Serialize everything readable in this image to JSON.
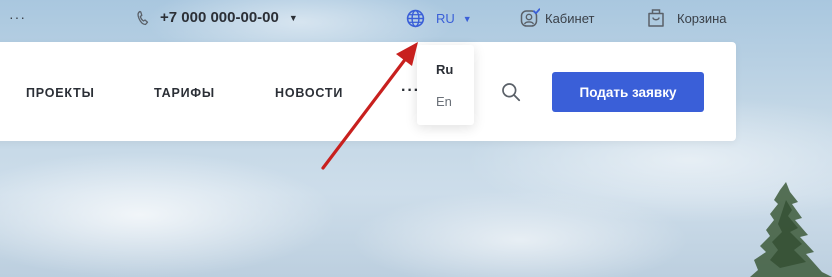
{
  "topbar": {
    "more_label": "···",
    "phone": "+7 000 000-00-00",
    "language": "RU",
    "cabinet_label": "Кабинет",
    "cart_label": "Корзина"
  },
  "nav": {
    "items": [
      "ПРОЕКТЫ",
      "ТАРИФЫ",
      "НОВОСТИ"
    ],
    "more_label": "···",
    "cta_label": "Подать заявку"
  },
  "language_dropdown": {
    "options": [
      "Ru",
      "En"
    ],
    "selected": "Ru"
  },
  "colors": {
    "accent": "#3a5fd8",
    "annotation_arrow": "#c8201e"
  },
  "icons": [
    "phone-icon",
    "globe-icon",
    "user-icon",
    "cart-icon",
    "search-icon"
  ]
}
